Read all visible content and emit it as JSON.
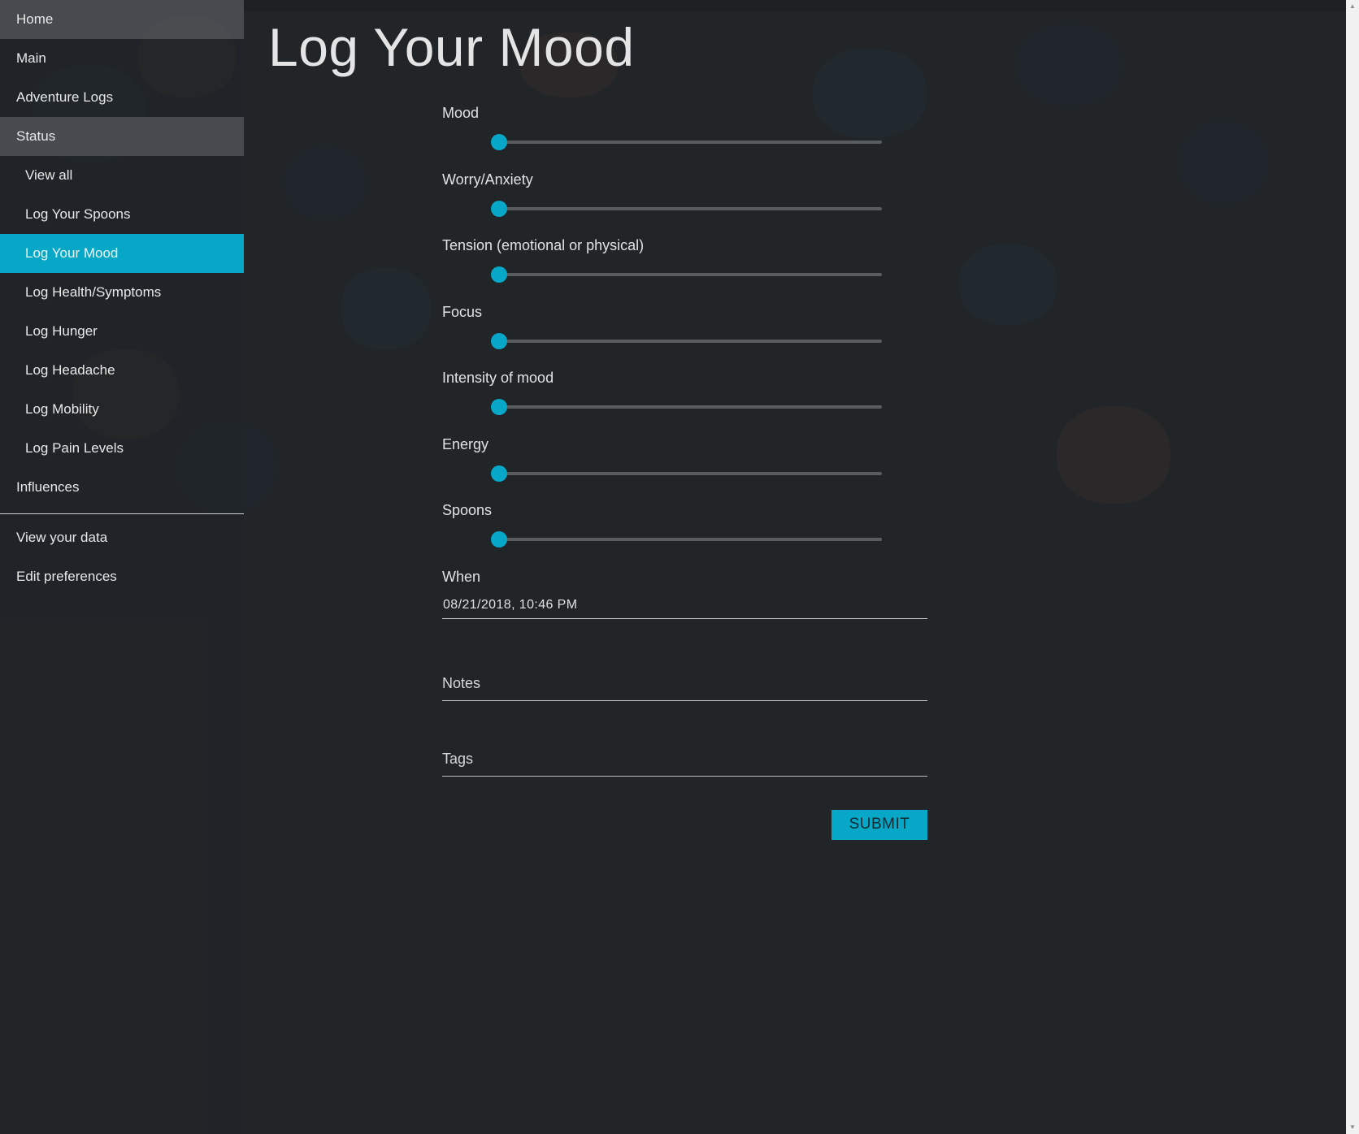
{
  "nav": {
    "items": [
      {
        "label": "Home"
      },
      {
        "label": "Main"
      },
      {
        "label": "Adventure Logs"
      },
      {
        "label": "Status"
      },
      {
        "label": "View all"
      },
      {
        "label": "Log Your Spoons"
      },
      {
        "label": "Log Your Mood"
      },
      {
        "label": "Log Health/Symptoms"
      },
      {
        "label": "Log Hunger"
      },
      {
        "label": "Log Headache"
      },
      {
        "label": "Log Mobility"
      },
      {
        "label": "Log Pain Levels"
      },
      {
        "label": "Influences"
      }
    ],
    "lower_items": [
      {
        "label": "View your data"
      },
      {
        "label": "Edit preferences"
      }
    ],
    "active_item": "Log Your Mood"
  },
  "page": {
    "title": "Log Your Mood"
  },
  "form": {
    "sliders": [
      {
        "label": "Mood",
        "value": 0
      },
      {
        "label": "Worry/Anxiety",
        "value": 0
      },
      {
        "label": "Tension (emotional or physical)",
        "value": 0
      },
      {
        "label": "Focus",
        "value": 0
      },
      {
        "label": "Intensity of mood",
        "value": 0
      },
      {
        "label": "Energy",
        "value": 0
      },
      {
        "label": "Spoons",
        "value": 0
      }
    ],
    "when": {
      "label": "When",
      "value": "08/21/2018, 10:46 PM"
    },
    "notes": {
      "placeholder": "Notes"
    },
    "tags": {
      "placeholder": "Tags"
    },
    "submit_label": "SUBMIT"
  },
  "colors": {
    "accent": "#06a7c7",
    "background": "#212528",
    "track": "#595d60"
  },
  "icons": {
    "scroll_up": "scroll-up-arrow-icon",
    "scroll_down": "scroll-down-arrow-icon"
  }
}
